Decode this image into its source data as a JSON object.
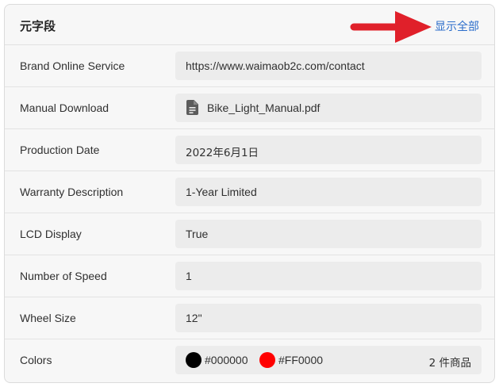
{
  "header": {
    "title": "元字段",
    "show_all": "显示全部"
  },
  "rows": [
    {
      "label": "Brand Online Service",
      "value": "https://www.waimaob2c.com/contact"
    },
    {
      "label": "Manual Download",
      "value": "Bike_Light_Manual.pdf",
      "icon": "document-icon"
    },
    {
      "label": "Production Date",
      "value": "2022年6月1日"
    },
    {
      "label": "Warranty Description",
      "value": "1-Year Limited"
    },
    {
      "label": "LCD Display",
      "value": "True"
    },
    {
      "label": "Number of Speed",
      "value": "1"
    },
    {
      "label": "Wheel Size",
      "value": "12\""
    },
    {
      "label": "Colors",
      "colors": [
        {
          "hex": "#000000",
          "label": "#000000"
        },
        {
          "hex": "#FF0000",
          "label": "#FF0000"
        }
      ],
      "count": "2 件商品"
    }
  ],
  "annotation": {
    "arrow_color": "#e0202a"
  }
}
